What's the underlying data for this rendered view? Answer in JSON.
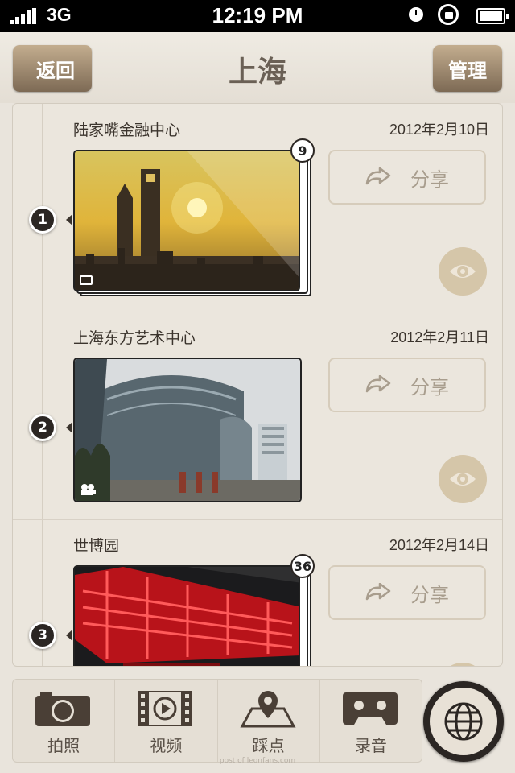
{
  "status_bar": {
    "carrier": "3G",
    "time": "12:19 PM"
  },
  "nav": {
    "back_label": "返回",
    "title": "上海",
    "manage_label": "管理"
  },
  "entries": [
    {
      "number": "1",
      "title": "陆家嘴金融中心",
      "date": "2012年2月10日",
      "count": "9",
      "media_type": "image-icon",
      "share_label": "分享"
    },
    {
      "number": "2",
      "title": "上海东方艺术中心",
      "date": "2012年2月11日",
      "count": "",
      "media_type": "video-camera-icon",
      "share_label": "分享"
    },
    {
      "number": "3",
      "title": "世博园",
      "date": "2012年2月14日",
      "count": "36",
      "media_type": "image-icon",
      "share_label": "分享"
    }
  ],
  "tabs": [
    {
      "label": "拍照",
      "icon": "camera-icon"
    },
    {
      "label": "视频",
      "icon": "film-icon"
    },
    {
      "label": "踩点",
      "icon": "map-pin-icon"
    },
    {
      "label": "录音",
      "icon": "cassette-icon"
    }
  ],
  "globe": {
    "icon": "globe-icon"
  },
  "watermark": "post of leonfans.com"
}
